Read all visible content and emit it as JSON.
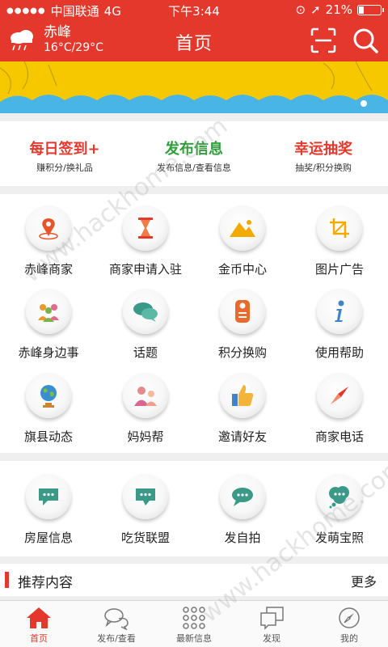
{
  "status_bar": {
    "carrier": "中国联通",
    "network": "4G",
    "time": "下午3:44",
    "battery": "21%"
  },
  "header": {
    "city": "赤峰",
    "temperature": "16°C/29°C",
    "title": "首页",
    "weather_icon": "cloud-rain-icon"
  },
  "banner": {
    "colors": [
      "#f5c800",
      "#49b5e6"
    ]
  },
  "quick_actions": [
    {
      "title": "每日签到+",
      "subtitle": "赚积分/换礼品",
      "color": "#e5382c"
    },
    {
      "title": "发布信息",
      "subtitle": "发布信息/查看信息",
      "color": "#2f9e3b"
    },
    {
      "title": "幸运抽奖",
      "subtitle": "抽奖/积分换购",
      "color": "#e5382c"
    }
  ],
  "grid_main": [
    {
      "label": "赤峰商家",
      "icon": "location-pin-icon"
    },
    {
      "label": "商家申请入驻",
      "icon": "hourglass-icon"
    },
    {
      "label": "金币中心",
      "icon": "mountain-icon"
    },
    {
      "label": "图片广告",
      "icon": "crop-icon"
    },
    {
      "label": "赤峰身边事",
      "icon": "people-icon"
    },
    {
      "label": "话题",
      "icon": "chat-bubbles-icon"
    },
    {
      "label": "积分换购",
      "icon": "door-tag-icon"
    },
    {
      "label": "使用帮助",
      "icon": "info-icon"
    },
    {
      "label": "旗县动态",
      "icon": "globe-icon"
    },
    {
      "label": "妈妈帮",
      "icon": "family-icon"
    },
    {
      "label": "邀请好友",
      "icon": "thumbs-up-icon"
    },
    {
      "label": "商家电话",
      "icon": "compass-icon"
    }
  ],
  "grid_secondary": [
    {
      "label": "房屋信息",
      "icon": "message-icon"
    },
    {
      "label": "吃货联盟",
      "icon": "message-icon"
    },
    {
      "label": "发自拍",
      "icon": "message-round-icon"
    },
    {
      "label": "发萌宝照",
      "icon": "message-cloud-icon"
    }
  ],
  "recommend": {
    "title": "推荐内容",
    "more": "更多"
  },
  "tabs": [
    {
      "label": "首页",
      "icon": "home-icon",
      "active": true
    },
    {
      "label": "发布/查看",
      "icon": "chat-icon",
      "active": false
    },
    {
      "label": "最新信息",
      "icon": "dots-grid-icon",
      "active": false
    },
    {
      "label": "发现",
      "icon": "discover-icon",
      "active": false
    },
    {
      "label": "我的",
      "icon": "compass-tab-icon",
      "active": false
    }
  ],
  "watermark": "www.hackhome.com"
}
